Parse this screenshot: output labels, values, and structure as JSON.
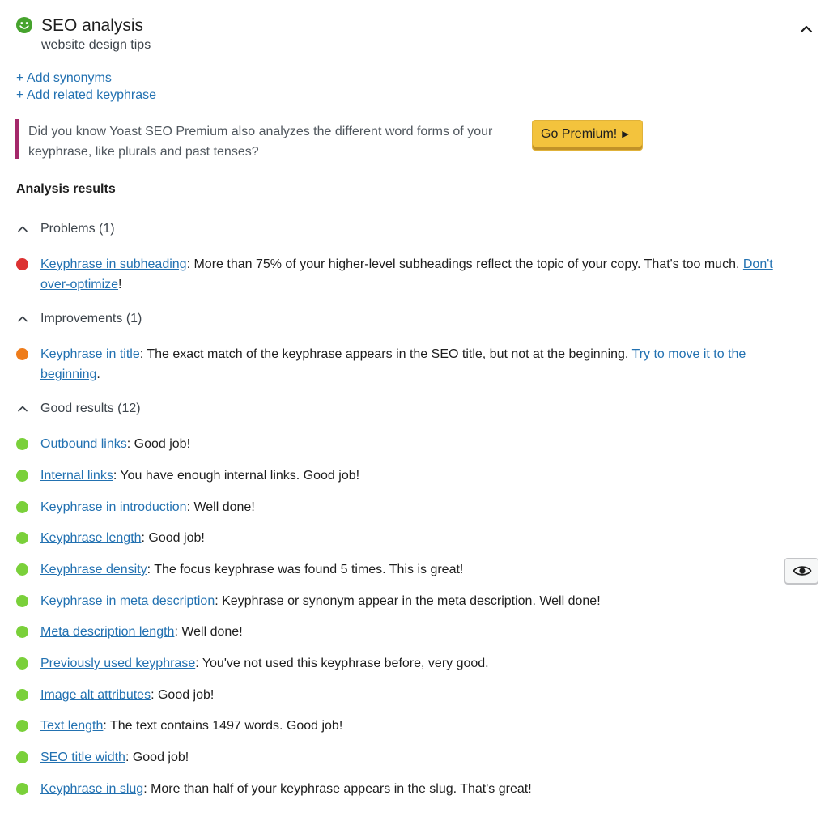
{
  "header": {
    "title": "SEO analysis",
    "subtitle": "website design tips",
    "status_color": "#46a32d"
  },
  "keyphrase_links": {
    "add_synonyms": "+ Add synonyms",
    "add_related": "+ Add related keyphrase"
  },
  "premium_notice": {
    "text": "Did you know Yoast SEO Premium also analyzes the different word forms of your keyphrase, like plurals and past tenses?",
    "button_label": "Go Premium!",
    "button_caret": "▶",
    "accent_color": "#a4286a",
    "button_color": "#f3c33d"
  },
  "analysis": {
    "heading": "Analysis results",
    "problems": {
      "label": "Problems (1)",
      "items": [
        {
          "link": "Keyphrase in subheading",
          "text": ": More than 75% of your higher-level subheadings reflect the topic of your copy. That's too much. ",
          "action": "Don't over-optimize",
          "after": "!"
        }
      ]
    },
    "improvements": {
      "label": "Improvements (1)",
      "items": [
        {
          "link": "Keyphrase in title",
          "text": ": The exact match of the keyphrase appears in the SEO title, but not at the beginning. ",
          "action": "Try to move it to the beginning",
          "after": "."
        }
      ]
    },
    "good": {
      "label": "Good results (12)",
      "items": [
        {
          "link": "Outbound links",
          "text": ": Good job!"
        },
        {
          "link": "Internal links",
          "text": ": You have enough internal links. Good job!"
        },
        {
          "link": "Keyphrase in introduction",
          "text": ": Well done!"
        },
        {
          "link": "Keyphrase length",
          "text": ": Good job!"
        },
        {
          "link": "Keyphrase density",
          "text": ": The focus keyphrase was found 5 times. This is great!"
        },
        {
          "link": "Keyphrase in meta description",
          "text": ": Keyphrase or synonym appear in the meta description. Well done!"
        },
        {
          "link": "Meta description length",
          "text": ": Well done!"
        },
        {
          "link": "Previously used keyphrase",
          "text": ": You've not used this keyphrase before, very good."
        },
        {
          "link": "Image alt attributes",
          "text": ": Good job!"
        },
        {
          "link": "Text length",
          "text": ": The text contains 1497 words. Good job!"
        },
        {
          "link": "SEO title width",
          "text": ": Good job!"
        },
        {
          "link": "Keyphrase in slug",
          "text": ": More than half of your keyphrase appears in the slug. That's great!"
        }
      ]
    }
  },
  "status_colors": {
    "bad": "#dc3232",
    "ok": "#ee7c1b",
    "good": "#7ad03a"
  },
  "icons": {
    "status": "smiley-face-icon",
    "collapse": "chevron-up-icon",
    "group_toggle": "chevron-up-icon",
    "highlight": "eye-icon"
  }
}
